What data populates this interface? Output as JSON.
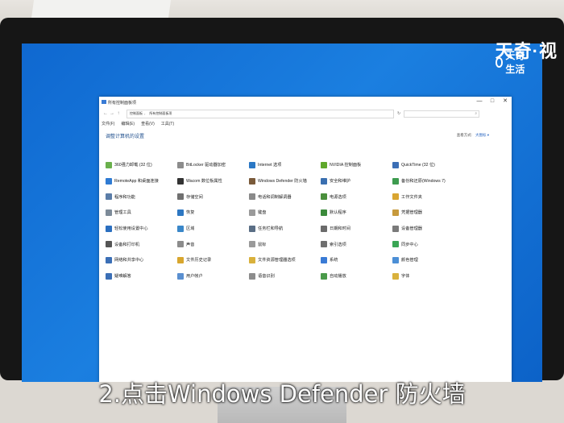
{
  "watermark": {
    "big": "天奇·视",
    "small": "天奇生活"
  },
  "window": {
    "title": "所有控制面板项",
    "buttons": [
      "—",
      "□",
      "✕"
    ],
    "address": {
      "crumbs": [
        "控制面板",
        "所有控制面板项"
      ],
      "nav": [
        "←",
        "→",
        "↑"
      ]
    },
    "menu": [
      "文件(F)",
      "编辑(E)",
      "查看(V)",
      "工具(T)"
    ],
    "heading": "调整计算机的设置",
    "view_by": {
      "label": "查看方式:",
      "value": "大图标 ▾"
    }
  },
  "items": [
    {
      "label": "360强力卸载 (32 位)",
      "color": "#6ab04c"
    },
    {
      "label": "BitLocker 驱动器加密",
      "color": "#8c8c8c"
    },
    {
      "label": "Internet 选项",
      "color": "#2b78c5"
    },
    {
      "label": "NVIDIA 控制面板",
      "color": "#5fa82b"
    },
    {
      "label": "QuickTime (32 位)",
      "color": "#3b6fb6"
    },
    {
      "label": "RemoteApp 和桌面连接",
      "color": "#2f7bd3"
    },
    {
      "label": "Wacom 数位板属性",
      "color": "#333333"
    },
    {
      "label": "Windows Defender 防火墙",
      "color": "#7a5a3a"
    },
    {
      "label": "安全和维护",
      "color": "#3a6fb0"
    },
    {
      "label": "备份和还原(Windows 7)",
      "color": "#3d9b4f"
    },
    {
      "label": "程序和功能",
      "color": "#5b7da8"
    },
    {
      "label": "存储空间",
      "color": "#707070"
    },
    {
      "label": "电话和调制解调器",
      "color": "#8a8a8a"
    },
    {
      "label": "电源选项",
      "color": "#4a8f3c"
    },
    {
      "label": "工作文件夹",
      "color": "#d9a531"
    },
    {
      "label": "管理工具",
      "color": "#7d8b99"
    },
    {
      "label": "恢复",
      "color": "#2d77c2"
    },
    {
      "label": "键盘",
      "color": "#9a9a9a"
    },
    {
      "label": "默认程序",
      "color": "#3b8a3b"
    },
    {
      "label": "凭据管理器",
      "color": "#c79a3d"
    },
    {
      "label": "轻松使用设置中心",
      "color": "#2b6fc0"
    },
    {
      "label": "区域",
      "color": "#3a87c9"
    },
    {
      "label": "任务栏和导航",
      "color": "#5a6e85"
    },
    {
      "label": "日期和时间",
      "color": "#6b6b6b"
    },
    {
      "label": "设备管理器",
      "color": "#7a7a7a"
    },
    {
      "label": "设备和打印机",
      "color": "#555555"
    },
    {
      "label": "声音",
      "color": "#8c8c8c"
    },
    {
      "label": "鼠标",
      "color": "#9a9a9a"
    },
    {
      "label": "索引选项",
      "color": "#6f6f6f"
    },
    {
      "label": "同步中心",
      "color": "#3aa655"
    },
    {
      "label": "网络和共享中心",
      "color": "#3b6fb6"
    },
    {
      "label": "文件历史记录",
      "color": "#d8a62e"
    },
    {
      "label": "文件资源管理器选项",
      "color": "#d9b13c"
    },
    {
      "label": "系统",
      "color": "#3a7bd5"
    },
    {
      "label": "颜色管理",
      "color": "#4c8fd6"
    },
    {
      "label": "疑难解答",
      "color": "#3b6fb6"
    },
    {
      "label": "用户帐户",
      "color": "#5a8fd0"
    },
    {
      "label": "语音识别",
      "color": "#8c8c8c"
    },
    {
      "label": "自动播放",
      "color": "#4a9a4a"
    },
    {
      "label": "字体",
      "color": "#d9b13c"
    }
  ],
  "caption": "2.点击Windows Defender 防火墙"
}
